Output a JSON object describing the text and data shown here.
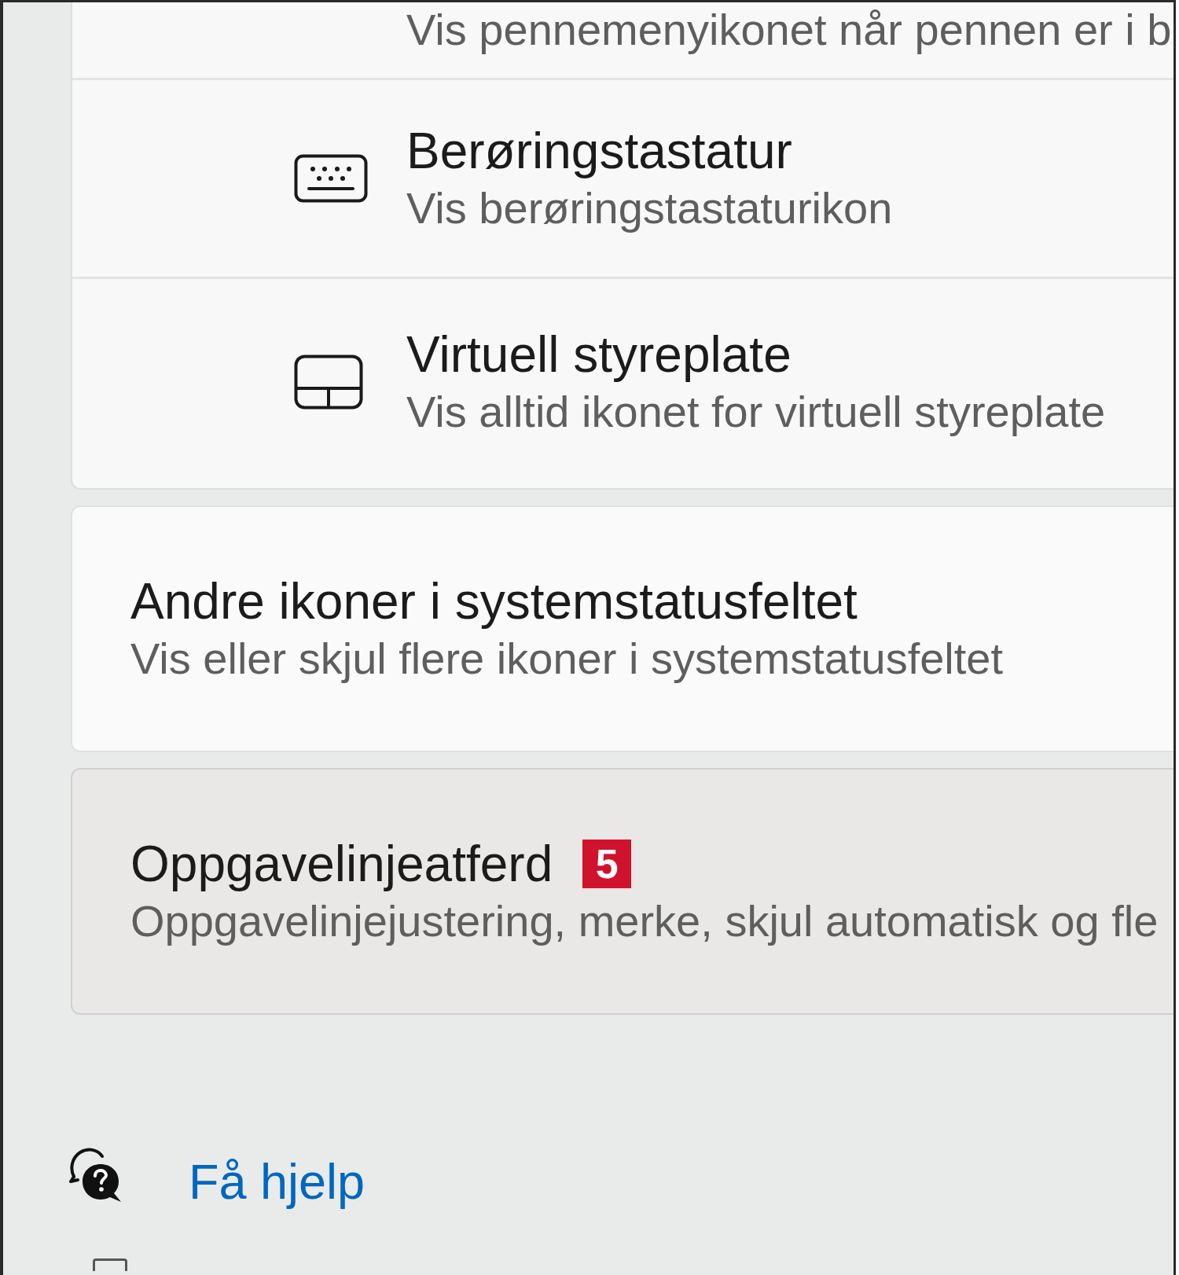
{
  "device_group": {
    "rows": [
      {
        "kind": "pen",
        "subtitle": "Vis pennemenyikonet når pennen er i b"
      },
      {
        "kind": "keyboard",
        "title": "Berøringstastatur",
        "subtitle": "Vis berøringstastaturikon"
      },
      {
        "kind": "touchpad",
        "title": "Virtuell styreplate",
        "subtitle": "Vis alltid ikonet for virtuell styreplate"
      }
    ]
  },
  "link_cards": [
    {
      "title": "Andre ikoner i systemstatusfeltet",
      "subtitle": "Vis eller skjul flere ikoner i systemstatusfeltet",
      "hovered": false
    },
    {
      "title": "Oppgavelinjeatferd",
      "badge": "5",
      "subtitle": "Oppgavelinjejustering, merke, skjul automatisk og fle",
      "hovered": true
    }
  ],
  "help_link": {
    "label": "Få hjelp"
  }
}
